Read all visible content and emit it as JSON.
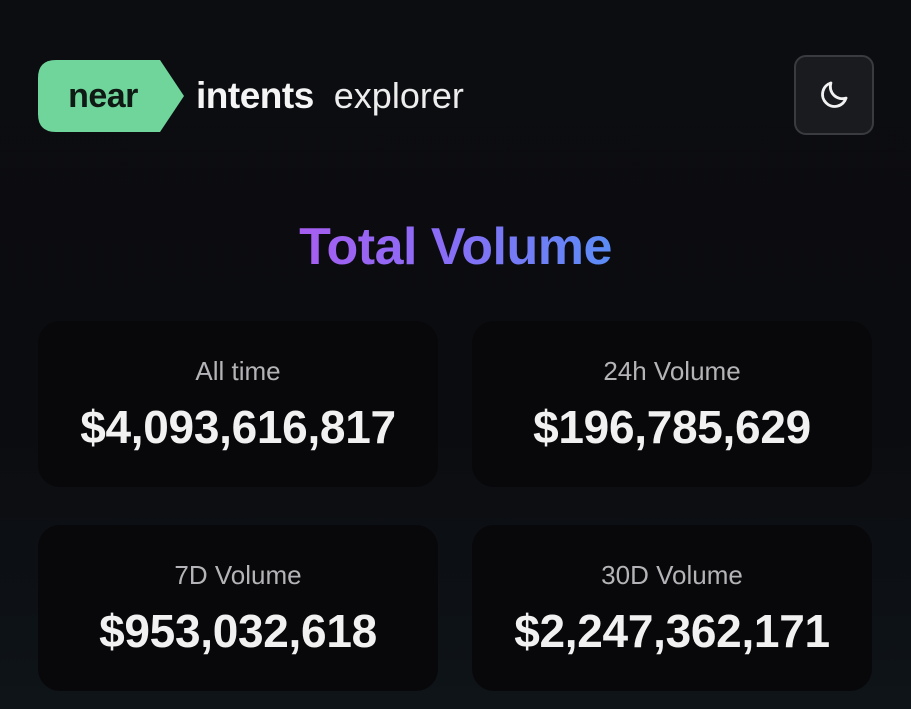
{
  "header": {
    "logo": {
      "badge_text": "near",
      "word_intents": "intents",
      "word_explorer": "explorer"
    },
    "theme_toggle": {
      "icon": "moon-icon"
    }
  },
  "title": "Total Volume",
  "stats": [
    {
      "label": "All time",
      "value": "$4,093,616,817"
    },
    {
      "label": "24h Volume",
      "value": "$196,785,629"
    },
    {
      "label": "7D Volume",
      "value": "$953,032,618"
    },
    {
      "label": "30D Volume",
      "value": "$2,247,362,171"
    }
  ],
  "colors": {
    "badge_green": "#6fd59a",
    "title_gradient_start": "#a65ef0",
    "title_gradient_end": "#5b8cf6",
    "background": "#0b0c10",
    "card_background": "#08080a"
  }
}
